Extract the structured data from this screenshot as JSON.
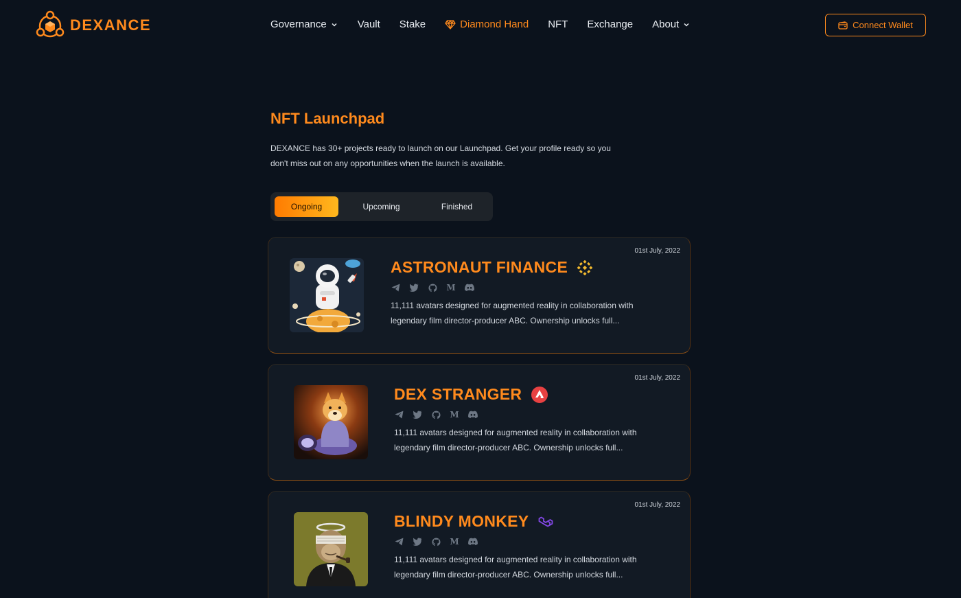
{
  "brand": {
    "name": "DEXANCE",
    "accent": "#ff8a1d",
    "background": "#0b121c"
  },
  "nav": [
    {
      "label": "Governance",
      "has_dropdown": true,
      "active": false
    },
    {
      "label": "Vault",
      "has_dropdown": false,
      "active": false
    },
    {
      "label": "Stake",
      "has_dropdown": false,
      "active": false
    },
    {
      "label": "Diamond Hand",
      "has_dropdown": false,
      "active": true,
      "icon": "diamond-icon"
    },
    {
      "label": "NFT",
      "has_dropdown": false,
      "active": false
    },
    {
      "label": "Exchange",
      "has_dropdown": false,
      "active": false
    },
    {
      "label": "About",
      "has_dropdown": true,
      "active": false
    }
  ],
  "header": {
    "connect_label": "Connect Wallet",
    "connect_icon": "wallet-icon"
  },
  "hero": {
    "title": "NFT Launchpad",
    "description": "DEXANCE has 30+ projects ready to launch on our Launchpad. Get your profile ready so you don't miss out on any opportunities when the launch is available."
  },
  "tabs": [
    {
      "label": "Ongoing",
      "active": true
    },
    {
      "label": "Upcoming",
      "active": false
    },
    {
      "label": "Finished",
      "active": false
    }
  ],
  "social_icons": [
    "telegram-icon",
    "twitter-icon",
    "github-icon",
    "medium-icon",
    "discord-icon"
  ],
  "projects": [
    {
      "title": "ASTRONAUT FINANCE",
      "date": "01st July, 2022",
      "chain": "binance-icon",
      "image": "astronaut-nft-image",
      "description": "11,111 avatars designed for augmented reality in collaboration with legendary film director-producer ABC. Ownership unlocks full..."
    },
    {
      "title": "DEX STRANGER",
      "date": "01st July, 2022",
      "chain": "avalanche-icon",
      "image": "doge-nft-image",
      "description": "11,111 avatars designed for augmented reality in collaboration with legendary film director-producer ABC. Ownership unlocks full..."
    },
    {
      "title": "BLINDY MONKEY",
      "date": "01st July, 2022",
      "chain": "polygon-icon",
      "image": "monkey-nft-image",
      "description": "11,111 avatars designed for augmented reality in collaboration with legendary film director-producer ABC. Ownership unlocks full..."
    }
  ]
}
